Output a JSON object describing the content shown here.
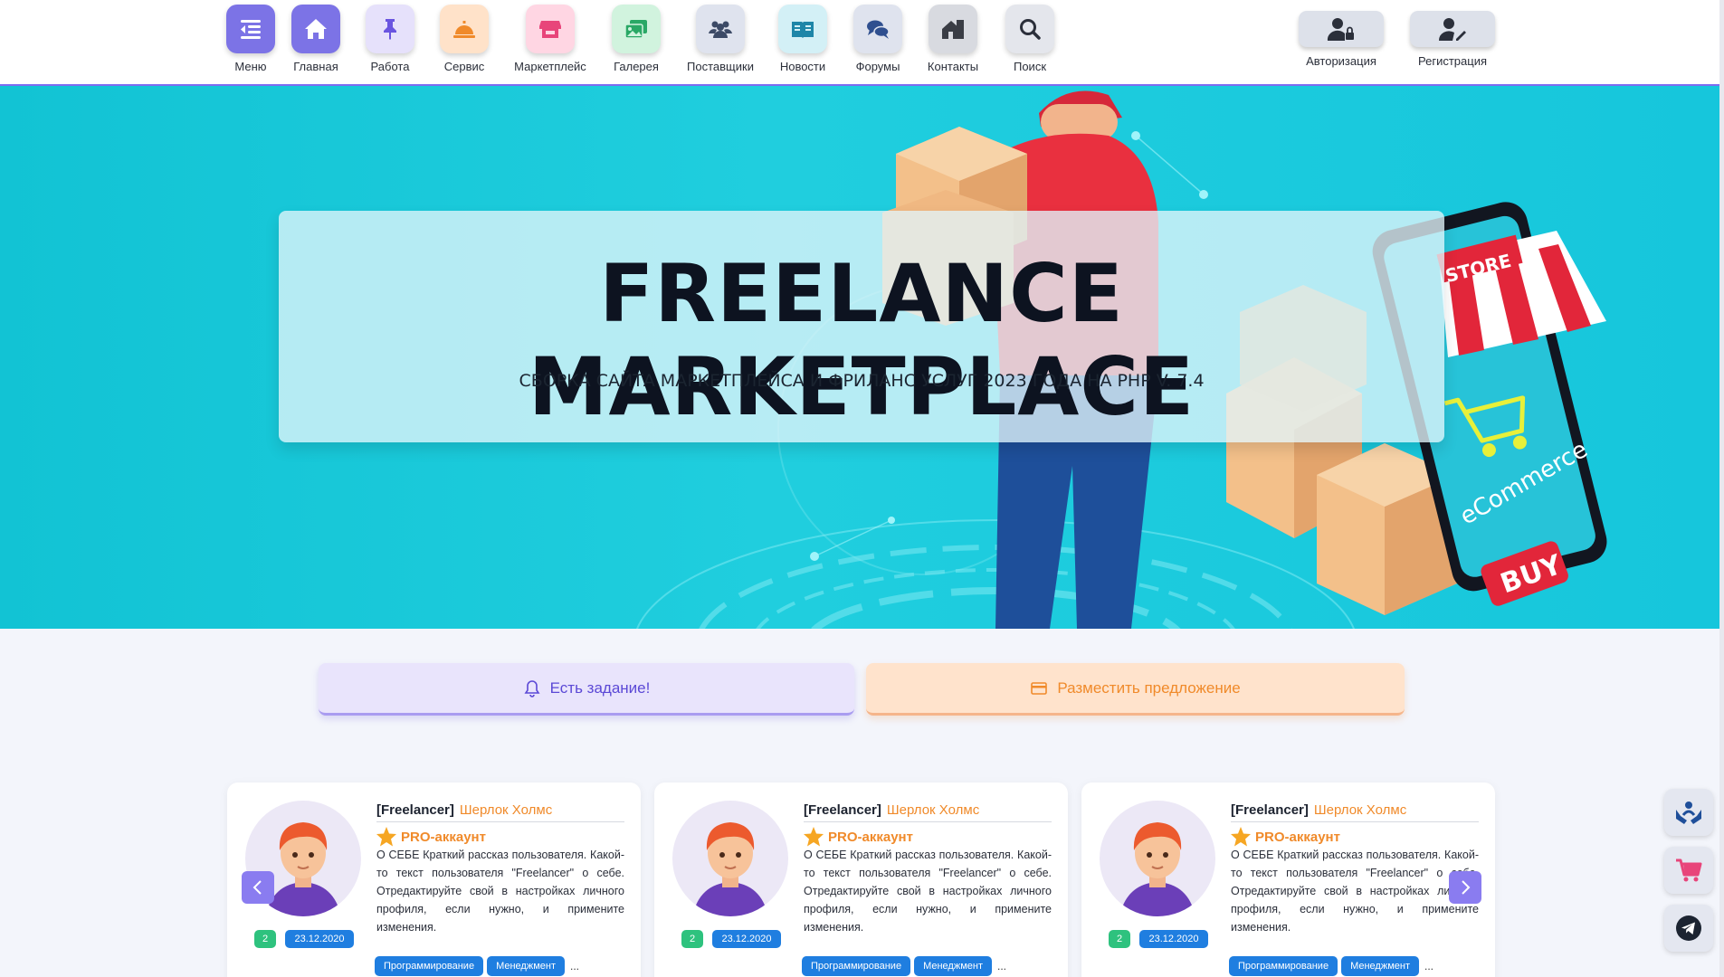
{
  "nav": {
    "items": [
      {
        "label": "Меню",
        "icon": "menu-icon",
        "bg": "#7c73e6"
      },
      {
        "label": "Главная",
        "icon": "home-icon",
        "bg": "#7c73e6"
      },
      {
        "label": "Работа",
        "icon": "pin-icon",
        "bg": "#e6e1fb"
      },
      {
        "label": "Сервис",
        "icon": "service-bell-icon",
        "bg": "#ffe2c9"
      },
      {
        "label": "Маркетплейс",
        "icon": "store-icon",
        "bg": "#ffd6e3"
      },
      {
        "label": "Галерея",
        "icon": "gallery-icon",
        "bg": "#d1f3de"
      },
      {
        "label": "Поставщики",
        "icon": "suppliers-icon",
        "bg": "#dfe3ee"
      },
      {
        "label": "Новости",
        "icon": "news-icon",
        "bg": "#d3f0f6"
      },
      {
        "label": "Форумы",
        "icon": "forum-icon",
        "bg": "#dfe3ee"
      },
      {
        "label": "Контакты",
        "icon": "contacts-icon",
        "bg": "#d8dae0"
      },
      {
        "label": "Поиск",
        "icon": "search-icon",
        "bg": "#e4e6ec"
      }
    ],
    "active": "Главная"
  },
  "auth": {
    "login_label": "Авторизация",
    "register_label": "Регистрация"
  },
  "hero": {
    "title": "FREELANCE MARKETPLACE",
    "subtitle": "СБОРКА САЙТА МАРКЕТПЛЕЙСА И ФРИЛАНС УСЛУГ 2023 ГОДА НА PHP V. 7.4",
    "store_sign": "STORE",
    "phone_text": "eCommerce",
    "buy_label": "BUY"
  },
  "actions": {
    "task_label": "Есть задание!",
    "offer_label": "Разместить предложение"
  },
  "cards": [
    {
      "role": "[Freelancer]",
      "name": "Шерлок Холмс",
      "pro": "PRO-аккаунт",
      "about": "О СЕБЕ Краткий рассказ пользователя. Какой-то текст пользователя \"Freelancer\" о себе. Отредактируйте свой в настройках личного профиля, если нужно, и примените изменения.",
      "count": "2",
      "date": "23.12.2020",
      "tags": [
        "Программирование",
        "Менеджмент"
      ],
      "more": "..."
    },
    {
      "role": "[Freelancer]",
      "name": "Шерлок Холмс",
      "pro": "PRO-аккаунт",
      "about": "О СЕБЕ Краткий рассказ пользователя. Какой-то текст пользователя \"Freelancer\" о себе. Отредактируйте свой в настройках личного профиля, если нужно, и примените изменения.",
      "count": "2",
      "date": "23.12.2020",
      "tags": [
        "Программирование",
        "Менеджмент"
      ],
      "more": "..."
    },
    {
      "role": "[Freelancer]",
      "name": "Шерлок Холмс",
      "pro": "PRO-аккаунт",
      "about": "О СЕБЕ Краткий рассказ пользователя. Какой-то текст пользователя \"Freelancer\" о себе. Отредактируйте свой в настройках личного профиля, если нужно, и примените изменения.",
      "count": "2",
      "date": "23.12.2020",
      "tags": [
        "Программирование",
        "Менеджмент"
      ],
      "more": "..."
    }
  ],
  "floating": [
    "support-icon",
    "cart-icon",
    "telegram-icon"
  ],
  "colors": {
    "accent": "#7c6cf0",
    "orange": "#f08a2a",
    "blue": "#1f7ee0",
    "green": "#2ec27e",
    "hero": "#20cede"
  }
}
